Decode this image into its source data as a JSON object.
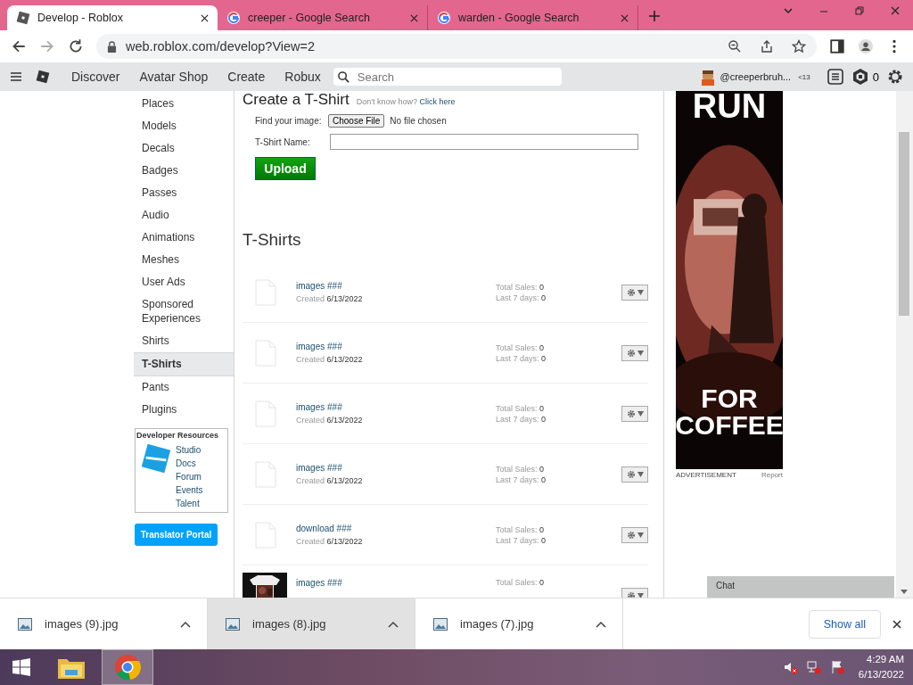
{
  "browser": {
    "tabs": [
      {
        "title": "Develop - Roblox",
        "selected": true,
        "kind": "roblox"
      },
      {
        "title": "creeper - Google Search",
        "selected": false,
        "kind": "google"
      },
      {
        "title": "warden - Google Search",
        "selected": false,
        "kind": "google"
      }
    ],
    "url": "web.roblox.com/develop?View=2"
  },
  "nav": {
    "links": [
      "Discover",
      "Avatar Shop",
      "Create",
      "Robux"
    ],
    "search_placeholder": "Search",
    "username": "@creeperbruh...",
    "age": "<13",
    "robux": "0"
  },
  "sidebar": {
    "items": [
      {
        "label": "Places",
        "selected": false
      },
      {
        "label": "Models",
        "selected": false
      },
      {
        "label": "Decals",
        "selected": false
      },
      {
        "label": "Badges",
        "selected": false
      },
      {
        "label": "Passes",
        "selected": false
      },
      {
        "label": "Audio",
        "selected": false
      },
      {
        "label": "Animations",
        "selected": false
      },
      {
        "label": "Meshes",
        "selected": false
      },
      {
        "label": "User Ads",
        "selected": false
      },
      {
        "label": "Sponsored Experiences",
        "selected": false
      },
      {
        "label": "Shirts",
        "selected": false
      },
      {
        "label": "T-Shirts",
        "selected": true
      },
      {
        "label": "Pants",
        "selected": false
      },
      {
        "label": "Plugins",
        "selected": false
      }
    ],
    "resources": {
      "title": "Developer Resources",
      "links": [
        "Studio",
        "Docs",
        "Forum",
        "Events",
        "Talent"
      ]
    },
    "translator": "Translator Portal"
  },
  "create": {
    "title": "Create a T-Shirt",
    "help": "Don't know how?",
    "help_link": "Click here",
    "file_label": "Find your image:",
    "file_button": "Choose File",
    "file_status": "No file chosen",
    "name_label": "T-Shirt Name:",
    "upload": "Upload"
  },
  "list": {
    "title": "T-Shirts",
    "items": [
      {
        "name": "images ###",
        "kind": "file",
        "created_label": "Created",
        "created": "6/13/2022",
        "sales_label": "Total Sales:",
        "sales": "0",
        "week_label": "Last 7 days:",
        "week": "0"
      },
      {
        "name": "images ###",
        "kind": "file",
        "created_label": "Created",
        "created": "6/13/2022",
        "sales_label": "Total Sales:",
        "sales": "0",
        "week_label": "Last 7 days:",
        "week": "0"
      },
      {
        "name": "images ###",
        "kind": "file",
        "created_label": "Created",
        "created": "6/13/2022",
        "sales_label": "Total Sales:",
        "sales": "0",
        "week_label": "Last 7 days:",
        "week": "0"
      },
      {
        "name": "images ###",
        "kind": "file",
        "created_label": "Created",
        "created": "6/13/2022",
        "sales_label": "Total Sales:",
        "sales": "0",
        "week_label": "Last 7 days:",
        "week": "0"
      },
      {
        "name": "download ###",
        "kind": "file",
        "created_label": "Created",
        "created": "6/13/2022",
        "sales_label": "Total Sales:",
        "sales": "0",
        "week_label": "Last 7 days:",
        "week": "0"
      },
      {
        "name": "images ###",
        "kind": "picture",
        "sales_label": "Total Sales:",
        "sales": "0"
      }
    ]
  },
  "ad": {
    "top": "RUN",
    "bottom": [
      "FOR",
      "COFFEE"
    ],
    "label": "ADVERTISEMENT",
    "report": "Report"
  },
  "chat": "Chat",
  "downloads": {
    "items": [
      {
        "name": "images (9).jpg",
        "selected": false
      },
      {
        "name": "images (8).jpg",
        "selected": true
      },
      {
        "name": "images (7).jpg",
        "selected": false
      }
    ],
    "show_all": "Show all"
  },
  "taskbar": {
    "time": "4:29 AM",
    "date": "6/13/2022"
  }
}
